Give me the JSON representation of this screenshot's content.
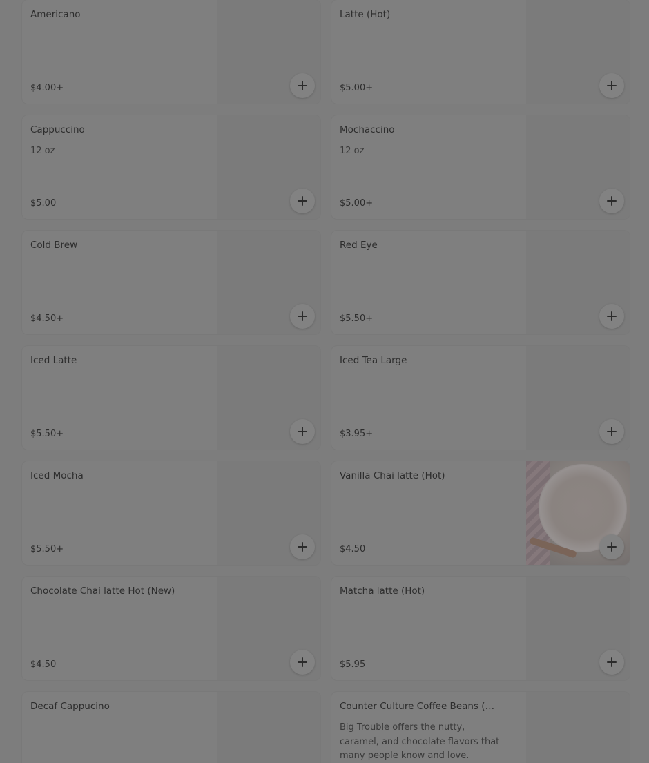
{
  "menu": {
    "items": [
      {
        "name": "Americano",
        "description": "",
        "price": "$4.00+",
        "has_image": false
      },
      {
        "name": "Latte (Hot)",
        "description": "",
        "price": "$5.00+",
        "has_image": false
      },
      {
        "name": "Cappuccino",
        "description": "12 oz",
        "price": "$5.00",
        "has_image": false
      },
      {
        "name": "Mochaccino",
        "description": "12 oz",
        "price": "$5.00+",
        "has_image": false
      },
      {
        "name": "Cold Brew",
        "description": "",
        "price": "$4.50+",
        "has_image": false
      },
      {
        "name": "Red Eye",
        "description": "",
        "price": "$5.50+",
        "has_image": false
      },
      {
        "name": "Iced Latte",
        "description": "",
        "price": "$5.50+",
        "has_image": false
      },
      {
        "name": "Iced Tea Large",
        "description": "",
        "price": "$3.95+",
        "has_image": false
      },
      {
        "name": "Iced Mocha",
        "description": "",
        "price": "$5.50+",
        "has_image": false
      },
      {
        "name": "Vanilla Chai latte (Hot)",
        "description": "",
        "price": "$4.50",
        "has_image": true
      },
      {
        "name": "Chocolate Chai latte Hot (New)",
        "description": "",
        "price": "$4.50",
        "has_image": false
      },
      {
        "name": "Matcha latte (Hot)",
        "description": "",
        "price": "$5.95",
        "has_image": false
      },
      {
        "name": "Decaf Cappucino",
        "description": "",
        "price": "",
        "has_image": false
      },
      {
        "name": "Counter Culture Coffee Beans (Bl...",
        "description": "Big Trouble offers the nutty, caramel, and chocolate flavors that many people know and love.",
        "price": "",
        "has_image": false
      }
    ]
  },
  "icons": {
    "add": "plus-icon"
  }
}
